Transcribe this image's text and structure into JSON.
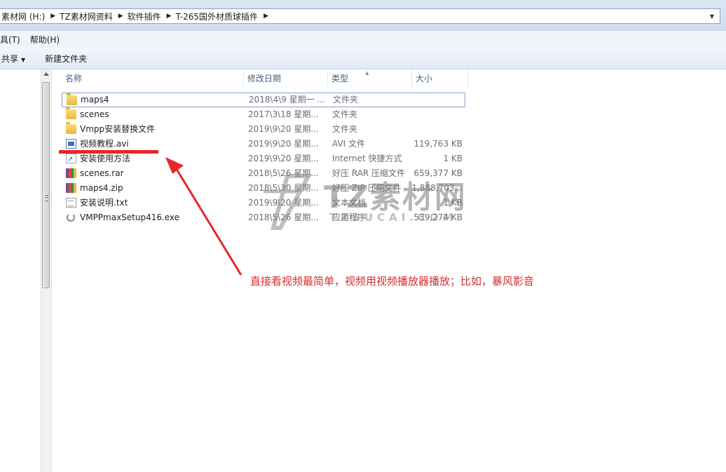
{
  "address": {
    "crumbs": [
      "素材网 (H:)",
      "TZ素材网资料",
      "软件插件",
      "T-265国外材质球插件"
    ]
  },
  "menu": {
    "tools": "具(T)",
    "help": "帮助(H)"
  },
  "toolbar": {
    "share": "共享",
    "new_folder": "新建文件夹"
  },
  "columns": {
    "name": "名称",
    "date": "修改日期",
    "type": "类型",
    "size": "大小"
  },
  "files": [
    {
      "name": "maps4",
      "date": "2018\\4\\9 星期一 ...",
      "type": "文件夹",
      "size": "",
      "icon": "folder-icon"
    },
    {
      "name": "scenes",
      "date": "2017\\3\\18 星期...",
      "type": "文件夹",
      "size": "",
      "icon": "folder-icon"
    },
    {
      "name": "Vmpp安装替换文件",
      "date": "2019\\9\\20 星期...",
      "type": "文件夹",
      "size": "",
      "icon": "folder-icon"
    },
    {
      "name": "视频教程.avi",
      "date": "2019\\9\\20 星期...",
      "type": "AVI 文件",
      "size": "119,763 KB",
      "icon": "video-file-icon"
    },
    {
      "name": "安装使用方法",
      "date": "2019\\9\\20 星期...",
      "type": "Internet 快捷方式",
      "size": "1 KB",
      "icon": "shortcut-icon"
    },
    {
      "name": "scenes.rar",
      "date": "2018\\5\\26 星期...",
      "type": "好压 RAR 压缩文件",
      "size": "659,377 KB",
      "icon": "archive-icon"
    },
    {
      "name": "maps4.zip",
      "date": "2018\\5\\30 星期...",
      "type": "好压 ZIP 压缩文件",
      "size": "1,888,703...",
      "icon": "archive-icon"
    },
    {
      "name": "安装说明.txt",
      "date": "2019\\9\\20 星期...",
      "type": "文本文档",
      "size": "1 KB",
      "icon": "text-file-icon"
    },
    {
      "name": "VMPPmaxSetup416.exe",
      "date": "2018\\5\\26 星期...",
      "type": "应用程序",
      "size": "539,274 KB",
      "icon": "executable-icon"
    }
  ],
  "annotation": {
    "text": "直接看视频最简单，视频用视频播放器播放；比如，暴风影音",
    "color": "#d62d2d"
  },
  "watermark": {
    "title": "TZ素材网",
    "url": "TZSUCAI.COM"
  }
}
